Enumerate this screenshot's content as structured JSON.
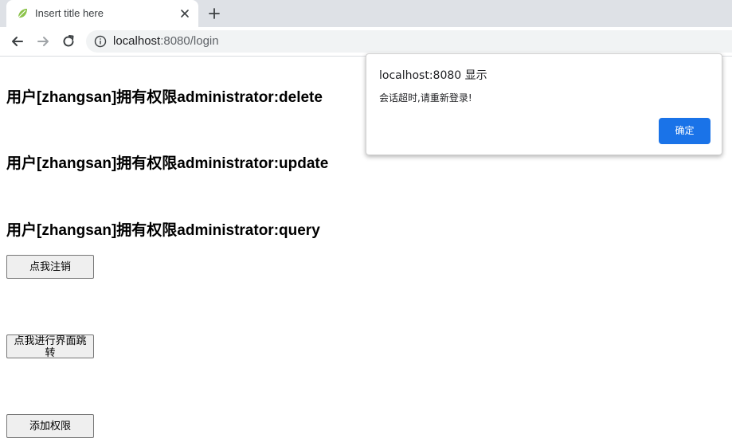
{
  "browser": {
    "tab": {
      "title": "Insert title here",
      "favicon": "leaf-icon"
    },
    "address_bar": {
      "host": "localhost",
      "port_path": ":8080/login"
    }
  },
  "page": {
    "permissions": [
      "用户[zhangsan]拥有权限administrator:delete",
      "用户[zhangsan]拥有权限administrator:update",
      "用户[zhangsan]拥有权限administrator:query"
    ],
    "buttons": {
      "logout": "点我注销",
      "navigate": "点我进行界面跳转",
      "add_permission": "添加权限"
    }
  },
  "dialog": {
    "title": "localhost:8080 显示",
    "message": "会话超时,请重新登录!",
    "ok_label": "确定"
  },
  "colors": {
    "accent": "#1a73e8",
    "tabstrip": "#dee1e6",
    "omnibox": "#f1f3f4"
  }
}
